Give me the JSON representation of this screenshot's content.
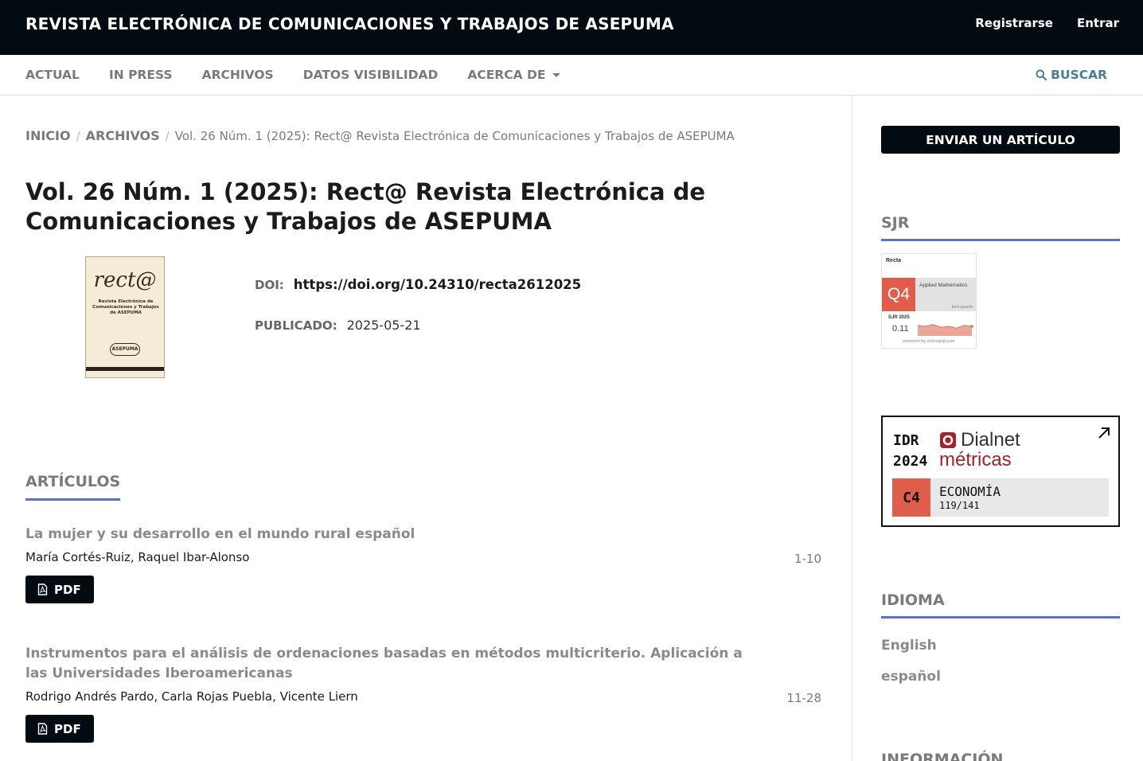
{
  "header": {
    "site_title": "REVISTA ELECTRÓNICA DE COMUNICACIONES Y TRABAJOS DE ASEPUMA",
    "register": "Registrarse",
    "login": "Entrar"
  },
  "nav": {
    "items": [
      "ACTUAL",
      "IN PRESS",
      "ARCHIVOS",
      "DATOS VISIBILIDAD",
      "ACERCA DE"
    ],
    "search": "BUSCAR"
  },
  "breadcrumb": {
    "home": "INICIO",
    "archives": "ARCHIVOS",
    "current": "Vol. 26 Núm. 1 (2025): Rect@ Revista Electrónica de Comunicaciones y Trabajos de ASEPUMA"
  },
  "issue": {
    "title": "Vol. 26 Núm. 1 (2025): Rect@ Revista Electrónica de Comunicaciones y Trabajos de ASEPUMA",
    "doi_label": "DOI:",
    "doi": "https://doi.org/10.24310/recta2612025",
    "published_label": "PUBLICADO:",
    "published": "2025-05-21",
    "cover": {
      "logo": "rect@",
      "subtitle": "Revista Electrónica de Comunicaciones y Trabajos de ASEPUMA",
      "seal": "ASEPUMA"
    }
  },
  "articles_section": "ARTÍCULOS",
  "articles": [
    {
      "title": "La mujer y su desarrollo en el mundo rural español",
      "authors": "María Cortés-Ruiz, Raquel Ibar-Alonso",
      "pages": "1-10",
      "pdf": "PDF"
    },
    {
      "title": "Instrumentos para el análisis de ordenaciones basadas en métodos multicriterio. Aplicación a las Universidades Iberoamericanas",
      "authors": "Rodrigo Andrés Pardo, Carla Rojas Puebla, Vicente Liern",
      "pages": "11-28",
      "pdf": "PDF"
    }
  ],
  "sidebar": {
    "submit": "ENVIAR UN ARTÍCULO",
    "sjr_heading": "SJR",
    "sjr": {
      "journal": "Recta",
      "quartile": "Q4",
      "category": "Applied Mathematics",
      "best": "best quartile",
      "year": "SJR 2025",
      "value": "0.11",
      "powered": "powered by scimagojr.com",
      "trend": [
        0.55,
        0.5,
        0.6,
        0.45,
        0.5,
        0.4,
        0.55,
        0.5
      ]
    },
    "dialnet": {
      "idr": "IDR",
      "year": "2024",
      "brand": "Dialnet",
      "metricas": "métricas",
      "quartile": "C4",
      "field": "ECONOMÍA",
      "rank": "119/141"
    },
    "language_heading": "IDIOMA",
    "languages": [
      "English",
      "español"
    ],
    "info_heading": "INFORMACIÓN"
  },
  "colors": {
    "header_bg": "#020b12",
    "accent": "#5672c9",
    "link_blue": "#4b7d96",
    "quartile_red": "#e05d4c",
    "dialnet_red": "#a3232d"
  }
}
